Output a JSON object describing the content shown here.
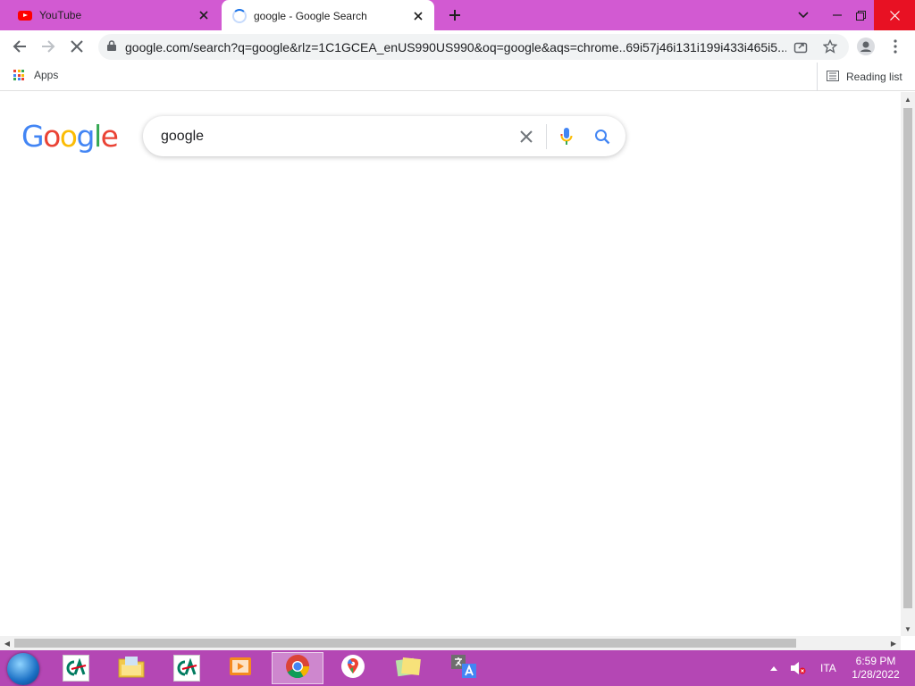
{
  "tabs": [
    {
      "title": "YouTube",
      "icon": "youtube-icon",
      "active": false
    },
    {
      "title": "google - Google Search",
      "icon": "loading-spinner-icon",
      "active": true
    }
  ],
  "toolbar": {
    "url": "google.com/search?q=google&rlz=1C1GCEA_enUS990US990&oq=google&aqs=chrome..69i57j46i131i199i433i465i5..."
  },
  "bookmarks": {
    "apps_label": "Apps",
    "reading_list_label": "Reading list"
  },
  "search": {
    "logo_letters": [
      "G",
      "o",
      "o",
      "g",
      "l",
      "e"
    ],
    "query": "google"
  },
  "colors": {
    "tabstrip": "#d25ad2",
    "taskbar": "#b447b4",
    "google_blue": "#4285f4",
    "google_red": "#ea4335",
    "google_yellow": "#fbbc05",
    "google_green": "#34a853"
  },
  "taskbar": {
    "items": [
      "credit-agricole-app",
      "file-explorer",
      "credit-agricole-app-2",
      "video-player",
      "chrome",
      "google-maps",
      "sticky-notes",
      "translator"
    ],
    "language": "ITA",
    "time": "6:59 PM",
    "date": "1/28/2022"
  }
}
